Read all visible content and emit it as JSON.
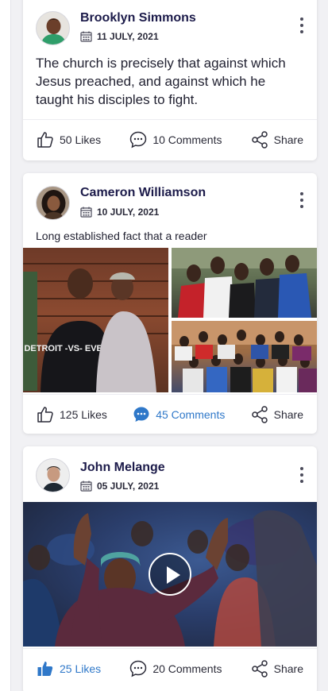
{
  "posts": [
    {
      "author": "Brooklyn Simmons",
      "date": "11 JULY, 2021",
      "text": "The church is precisely that against which Jesus preached, and against which he taught his disciples to fight.",
      "likes": "50 Likes",
      "comments": "10 Comments",
      "share": "Share",
      "liked": false,
      "commented": false
    },
    {
      "author": "Cameron Williamson",
      "date": "10 JULY, 2021",
      "text": "Long established fact that a reader",
      "shirt_text": "DETROIT -VS- EVERYBODY",
      "likes": "125 Likes",
      "comments": "45 Comments",
      "share": "Share",
      "liked": false,
      "commented": true
    },
    {
      "author": "John Melange",
      "date": "05 JULY, 2021",
      "likes": "25 Likes",
      "comments": "20 Comments",
      "share": "Share",
      "liked": true,
      "commented": false
    }
  ],
  "colors": {
    "accent": "#2f78c9",
    "author": "#1c1b4a",
    "background": "#f1f1f4"
  },
  "icons": {
    "calendar": "calendar-icon",
    "like": "thumbs-up-icon",
    "comment": "comment-icon",
    "share": "share-icon",
    "more": "more-vertical-icon",
    "play": "play-icon"
  }
}
